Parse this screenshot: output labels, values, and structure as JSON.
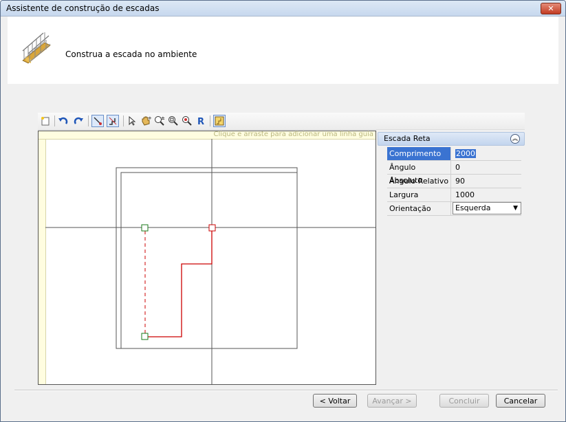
{
  "window": {
    "title": "Assistente de construção de escadas",
    "close_label": "✕"
  },
  "header": {
    "subtitle": "Construa a escada no ambiente"
  },
  "canvas": {
    "hint": "Clique e arraste para adicionar uma linha guia"
  },
  "properties": {
    "group_title": "Escada Reta",
    "rows": [
      {
        "label": "Comprimento",
        "value": "2000"
      },
      {
        "label": "Ângulo Absoluto",
        "value": "0"
      },
      {
        "label": "Ângulo Relativo",
        "value": "90"
      },
      {
        "label": "Largura",
        "value": "1000"
      },
      {
        "label": "Orientação",
        "value": "Esquerda"
      }
    ]
  },
  "buttons": {
    "back": "< Voltar",
    "next": "Avançar >",
    "finish": "Concluir",
    "cancel": "Cancelar"
  },
  "colors": {
    "path": "#cc0000",
    "point_start": "#1a7a1a",
    "point_end": "#cc0000",
    "selection": "#3a73d1"
  }
}
